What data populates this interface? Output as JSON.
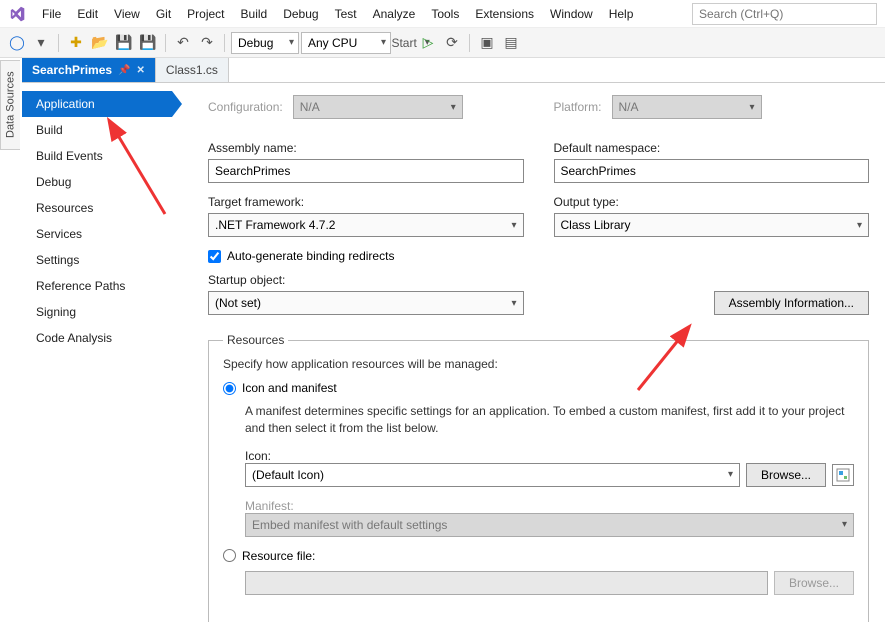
{
  "menubar": {
    "items": [
      "File",
      "Edit",
      "View",
      "Git",
      "Project",
      "Build",
      "Debug",
      "Test",
      "Analyze",
      "Tools",
      "Extensions",
      "Window",
      "Help"
    ]
  },
  "search": {
    "placeholder": "Search (Ctrl+Q)"
  },
  "toolbar": {
    "config": "Debug",
    "platform": "Any CPU",
    "start": "Start"
  },
  "sideTab": "Data Sources",
  "tabs": {
    "active": "SearchPrimes",
    "other": "Class1.cs"
  },
  "propNav": [
    "Application",
    "Build",
    "Build Events",
    "Debug",
    "Resources",
    "Services",
    "Settings",
    "Reference Paths",
    "Signing",
    "Code Analysis"
  ],
  "cfg": {
    "configurationLabel": "Configuration:",
    "configurationValue": "N/A",
    "platformLabel": "Platform:",
    "platformValue": "N/A"
  },
  "fields": {
    "assemblyNameLabel": "Assembly name:",
    "assemblyName": "SearchPrimes",
    "defaultNsLabel": "Default namespace:",
    "defaultNs": "SearchPrimes",
    "targetFwLabel": "Target framework:",
    "targetFw": ".NET Framework 4.7.2",
    "outputTypeLabel": "Output type:",
    "outputType": "Class Library",
    "autoRedirects": "Auto-generate binding redirects",
    "startupLabel": "Startup object:",
    "startup": "(Not set)",
    "assemblyInfoBtn": "Assembly Information..."
  },
  "resources": {
    "legend": "Resources",
    "desc": "Specify how application resources will be managed:",
    "iconManifest": "Icon and manifest",
    "manifestNote": "A manifest determines specific settings for an application. To embed a custom manifest, first add it to your project and then select it from the list below.",
    "iconLabel": "Icon:",
    "iconValue": "(Default Icon)",
    "browse": "Browse...",
    "manifestLabel": "Manifest:",
    "manifestValue": "Embed manifest with default settings",
    "resourceFile": "Resource file:"
  }
}
